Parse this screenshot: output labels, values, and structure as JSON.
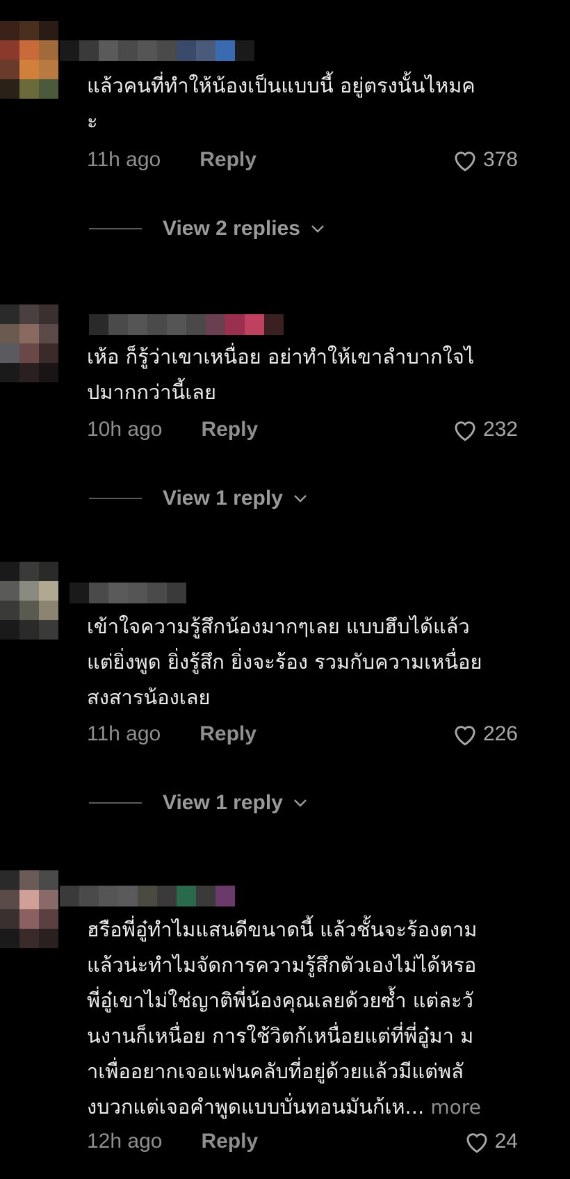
{
  "comments": [
    {
      "text": "แล้วคนที่ทำให้น้องเป็นแบบนี้ อยู่ตรงนั้นไหมค\nะ",
      "time": "11h ago",
      "reply_label": "Reply",
      "likes": "378",
      "view_replies": "View 2 replies"
    },
    {
      "text": "เห้อ ก็รู้ว่าเขาเหนื่อย อย่าทำให้เขาลำบากใจไ\nปมากกว่านี้เลย",
      "time": "10h ago",
      "reply_label": "Reply",
      "likes": "232",
      "view_replies": "View 1 reply"
    },
    {
      "text": "เข้าใจความรู้สึกน้องมากๆเลย แบบฮึบได้แล้ว\nแต่ยิ่งพูด ยิ่งรู้สึก ยิ่งจะร้อง รวมกับความเหนื่อย\nสงสารน้องเลย",
      "time": "11h ago",
      "reply_label": "Reply",
      "likes": "226",
      "view_replies": "View 1 reply"
    },
    {
      "text": "ฮรือพี่อู๋ทำไมแสนดีขนาดนี้ แล้วชั้นจะร้องตาม\nแล้วน่ะทำไมจัดการความรู้สึกตัวเองไม่ได้หรอ\nพี่อู๋เขาไม่ใช่ญาติพี่น้องคุณเลยด้วยซ้ำ แต่ละวั\nนงานก็เหนื่อย การใช้วิตก้เหนื่อยแต่ที่พี่อู๋มา ม\nาเพื่ออยากเจอแฟนคลับที่อยู่ด้วยแล้วมีแต่พลั\nงบวกแต่เจอคำพูดแบบบั่นทอนมันก้เห...",
      "more_label": "more",
      "time": "12h ago",
      "reply_label": "Reply",
      "likes": "24"
    }
  ],
  "colors": {
    "background": "#000000",
    "text": "#ececec",
    "muted": "#8f8f8f"
  },
  "icons": {
    "like": "heart-outline-icon",
    "expand": "chevron-down-icon"
  }
}
